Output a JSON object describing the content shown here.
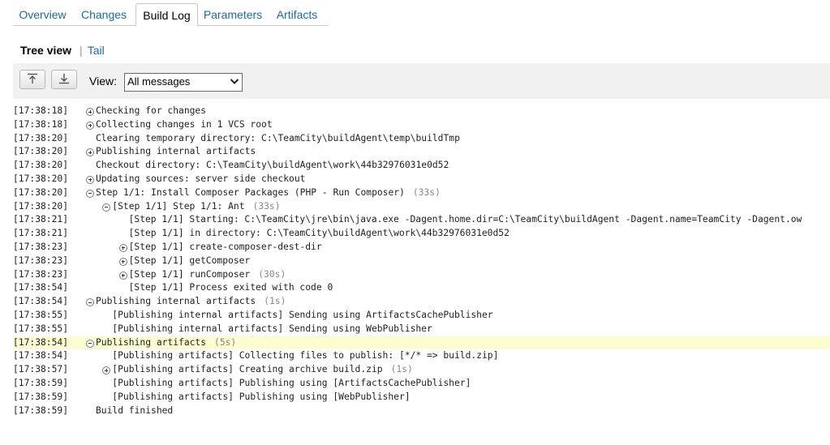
{
  "tabs": [
    "Overview",
    "Changes",
    "Build Log",
    "Parameters",
    "Artifacts"
  ],
  "view_switch": {
    "current": "Tree view",
    "separator": "|",
    "other": "Tail"
  },
  "toolbar": {
    "view_label": "View:",
    "view_value": "All messages"
  },
  "log": [
    {
      "ts": "[17:38:18]",
      "text": "Checking for changes",
      "dur": "",
      "level": 0,
      "toggle": "plus",
      "hl": false
    },
    {
      "ts": "[17:38:18]",
      "text": "Collecting changes in 1 VCS root",
      "dur": "",
      "level": 0,
      "toggle": "plus",
      "hl": false
    },
    {
      "ts": "[17:38:20]",
      "text": "Clearing temporary directory: C:\\TeamCity\\buildAgent\\temp\\buildTmp",
      "dur": "",
      "level": 0,
      "toggle": "",
      "hl": false
    },
    {
      "ts": "[17:38:20]",
      "text": "Publishing internal artifacts",
      "dur": "",
      "level": 0,
      "toggle": "plus",
      "hl": false
    },
    {
      "ts": "[17:38:20]",
      "text": "Checkout directory: C:\\TeamCity\\buildAgent\\work\\44b32976031e0d52",
      "dur": "",
      "level": 0,
      "toggle": "",
      "hl": false
    },
    {
      "ts": "[17:38:20]",
      "text": "Updating sources: server side checkout",
      "dur": "",
      "level": 0,
      "toggle": "plus",
      "hl": false
    },
    {
      "ts": "[17:38:20]",
      "text": "Step 1/1: Install Composer Packages (PHP - Run Composer)",
      "dur": "(33s)",
      "level": 0,
      "toggle": "minus",
      "hl": false
    },
    {
      "ts": "[17:38:20]",
      "text": "[Step 1/1] Step 1/1: Ant",
      "dur": "(33s)",
      "level": 1,
      "toggle": "minus",
      "hl": false
    },
    {
      "ts": "[17:38:21]",
      "text": "[Step 1/1] Starting: C:\\TeamCity\\jre\\bin\\java.exe -Dagent.home.dir=C:\\TeamCity\\buildAgent -Dagent.name=TeamCity -Dagent.ow",
      "dur": "",
      "level": 2,
      "toggle": "",
      "hl": false
    },
    {
      "ts": "[17:38:21]",
      "text": "[Step 1/1] in directory: C:\\TeamCity\\buildAgent\\work\\44b32976031e0d52",
      "dur": "",
      "level": 2,
      "toggle": "",
      "hl": false
    },
    {
      "ts": "[17:38:23]",
      "text": "[Step 1/1] create-composer-dest-dir",
      "dur": "",
      "level": 2,
      "toggle": "plus",
      "hl": false
    },
    {
      "ts": "[17:38:23]",
      "text": "[Step 1/1] getComposer",
      "dur": "",
      "level": 2,
      "toggle": "plus",
      "hl": false
    },
    {
      "ts": "[17:38:23]",
      "text": "[Step 1/1] runComposer",
      "dur": "(30s)",
      "level": 2,
      "toggle": "plus",
      "hl": false
    },
    {
      "ts": "[17:38:54]",
      "text": "[Step 1/1] Process exited with code 0",
      "dur": "",
      "level": 2,
      "toggle": "",
      "hl": false
    },
    {
      "ts": "[17:38:54]",
      "text": "Publishing internal artifacts",
      "dur": "(1s)",
      "level": 0,
      "toggle": "minus",
      "hl": false
    },
    {
      "ts": "[17:38:55]",
      "text": "[Publishing internal artifacts] Sending using ArtifactsCachePublisher",
      "dur": "",
      "level": 1,
      "toggle": "",
      "hl": false
    },
    {
      "ts": "[17:38:55]",
      "text": "[Publishing internal artifacts] Sending using WebPublisher",
      "dur": "",
      "level": 1,
      "toggle": "",
      "hl": false
    },
    {
      "ts": "[17:38:54]",
      "text": "Publishing artifacts",
      "dur": "(5s)",
      "level": 0,
      "toggle": "minus",
      "hl": true
    },
    {
      "ts": "[17:38:54]",
      "text": "[Publishing artifacts] Collecting files to publish: [*/* => build.zip]",
      "dur": "",
      "level": 1,
      "toggle": "",
      "hl": false
    },
    {
      "ts": "[17:38:57]",
      "text": "[Publishing artifacts] Creating archive build.zip",
      "dur": "(1s)",
      "level": 1,
      "toggle": "plus",
      "hl": false
    },
    {
      "ts": "[17:38:59]",
      "text": "[Publishing artifacts] Publishing using [ArtifactsCachePublisher]",
      "dur": "",
      "level": 1,
      "toggle": "",
      "hl": false
    },
    {
      "ts": "[17:38:59]",
      "text": "[Publishing artifacts] Publishing using [WebPublisher]",
      "dur": "",
      "level": 1,
      "toggle": "",
      "hl": false
    },
    {
      "ts": "[17:38:59]",
      "text": "Build finished",
      "dur": "",
      "level": 0,
      "toggle": "",
      "hl": false
    }
  ]
}
